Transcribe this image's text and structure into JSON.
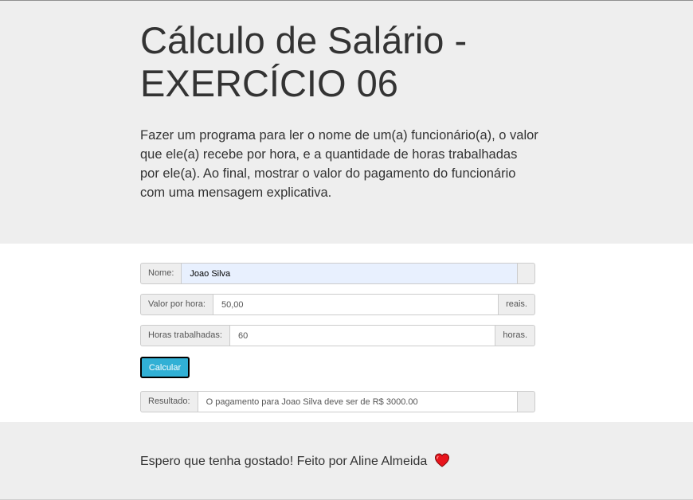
{
  "header": {
    "title": "Cálculo de Salário - EXERCÍCIO 06",
    "description": "Fazer um programa para ler o nome de um(a) funcionário(a), o valor que ele(a) recebe por hora, e a quantidade de horas trabalhadas por ele(a). Ao final, mostrar o valor do pagamento do funcionário com uma mensagem explicativa."
  },
  "form": {
    "nome": {
      "label": "Nome:",
      "value": "Joao Silva"
    },
    "valor_hora": {
      "label": "Valor por hora:",
      "value": "50,00",
      "suffix": "reais."
    },
    "horas": {
      "label": "Horas trabalhadas:",
      "value": "60",
      "suffix": "horas."
    },
    "calcular_label": "Calcular",
    "resultado": {
      "label": "Resultado:",
      "value": "O pagamento para Joao Silva deve ser de R$ 3000.00"
    }
  },
  "footer": {
    "text": "Espero que tenha gostado! Feito por Aline Almeida",
    "icon": "heart-icon"
  },
  "colors": {
    "jumbotron_bg": "#eeeeee",
    "button_bg": "#31b0d5",
    "heart": "#e8141c",
    "autofill_bg": "#e8f0fe"
  }
}
